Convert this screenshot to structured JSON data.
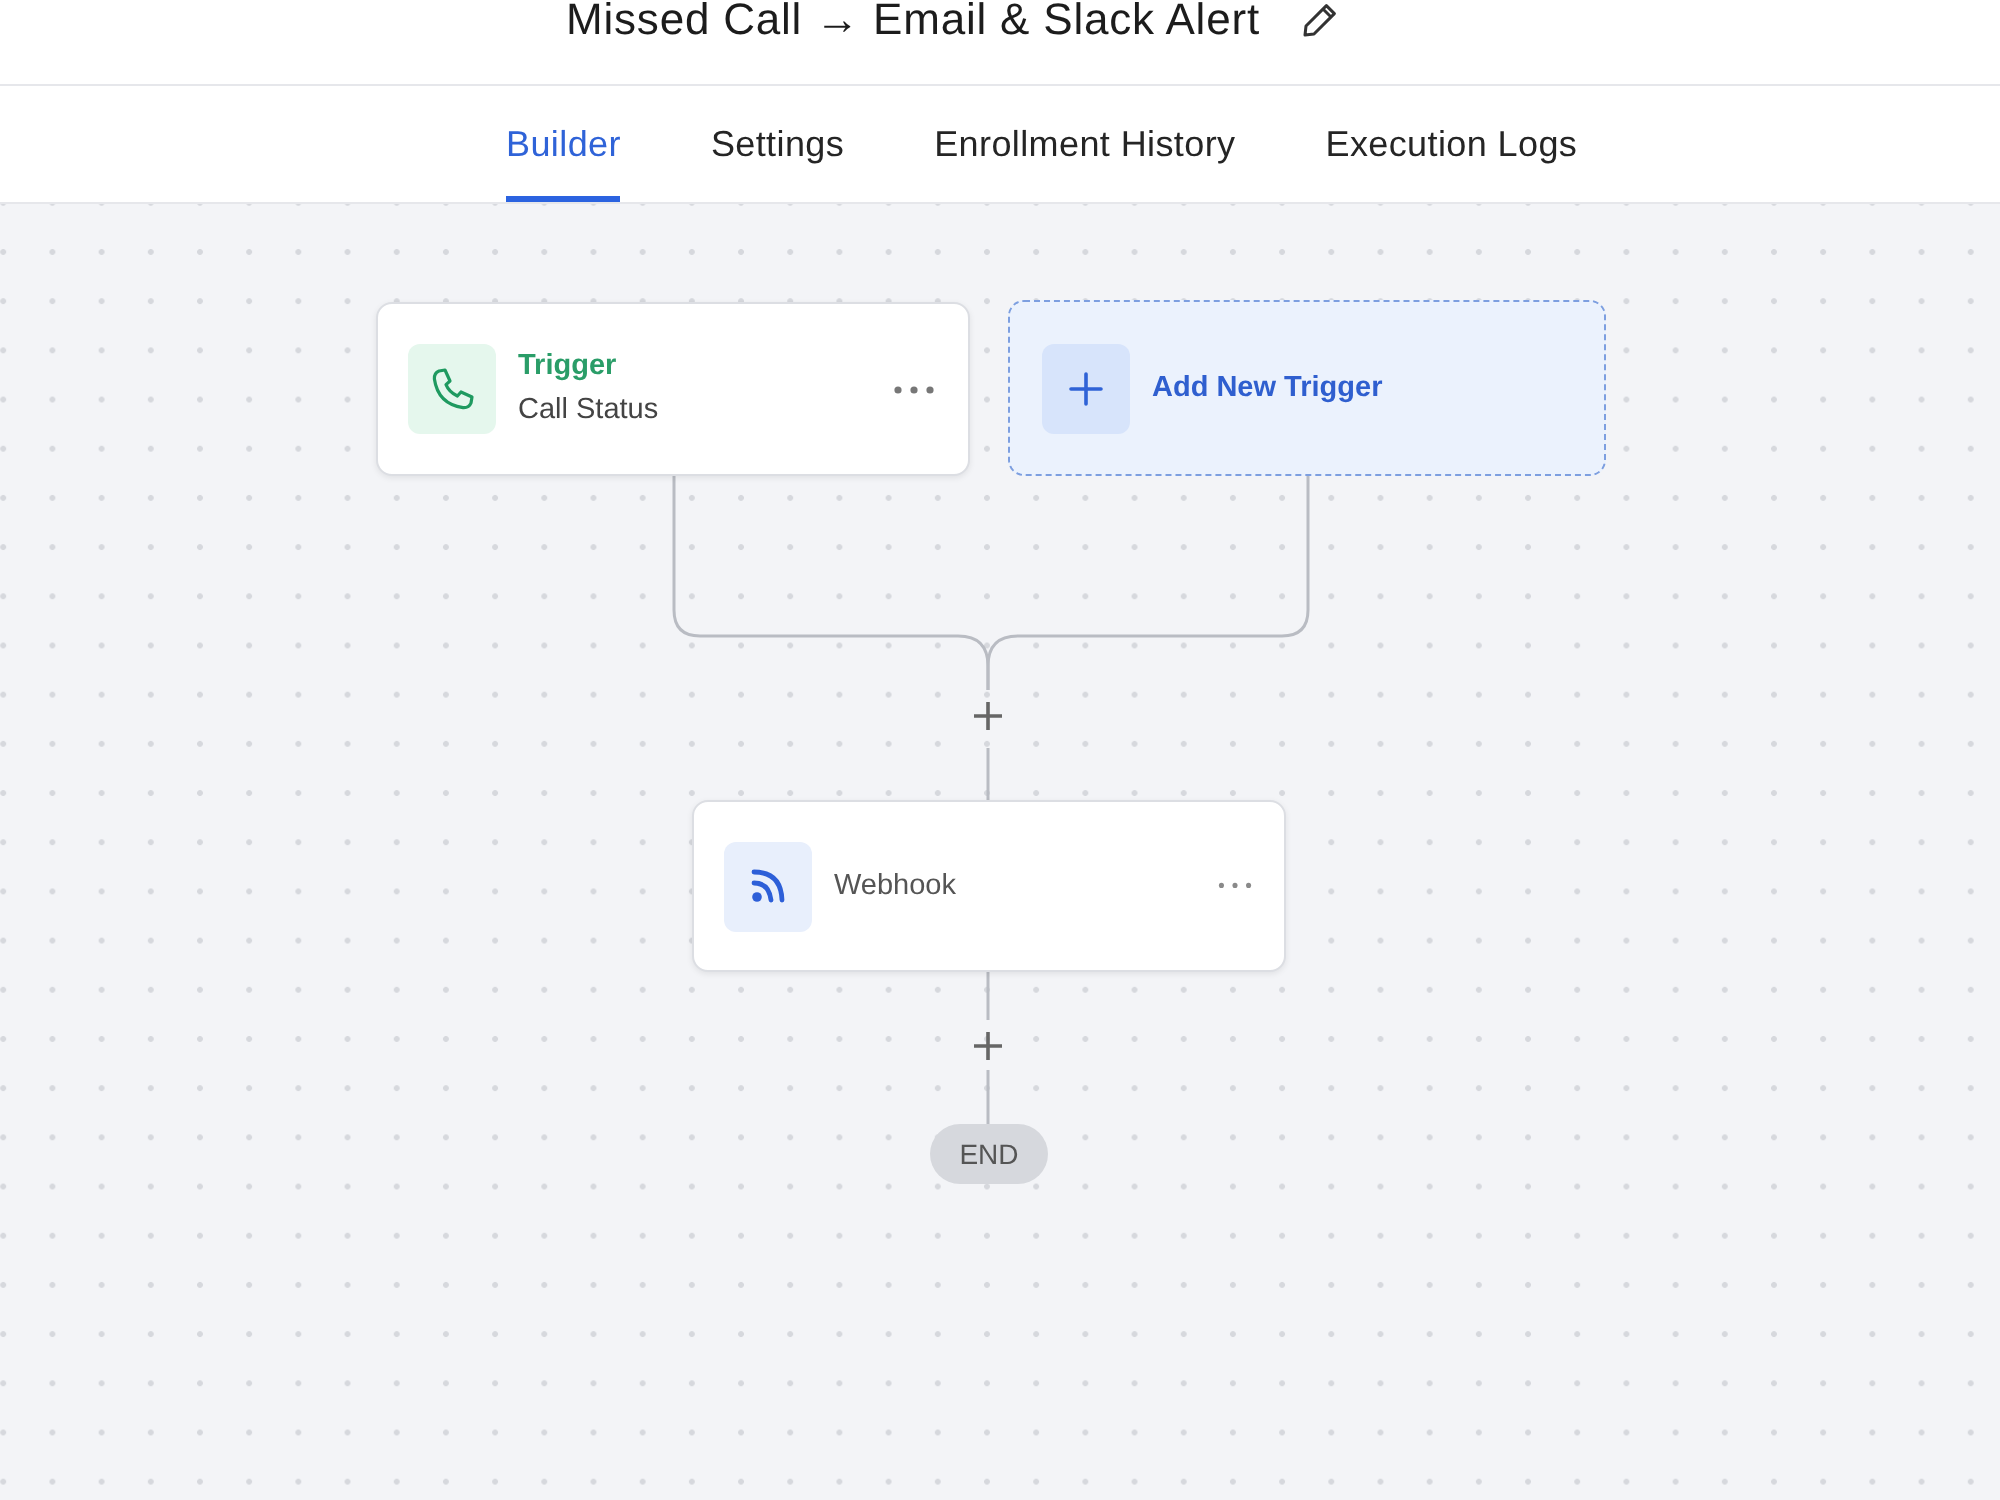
{
  "header": {
    "title": "Missed Call → Email & Slack Alert"
  },
  "tabs": [
    {
      "label": "Builder",
      "selected": true
    },
    {
      "label": "Settings",
      "selected": false
    },
    {
      "label": "Enrollment History",
      "selected": false
    },
    {
      "label": "Execution Logs",
      "selected": false
    }
  ],
  "trigger": {
    "title": "Trigger",
    "event": "Call Status"
  },
  "add_trigger": {
    "label": "Add New Trigger"
  },
  "steps": [
    {
      "kind": "webhook",
      "label": "Webhook"
    }
  ],
  "end": {
    "label": "END"
  }
}
